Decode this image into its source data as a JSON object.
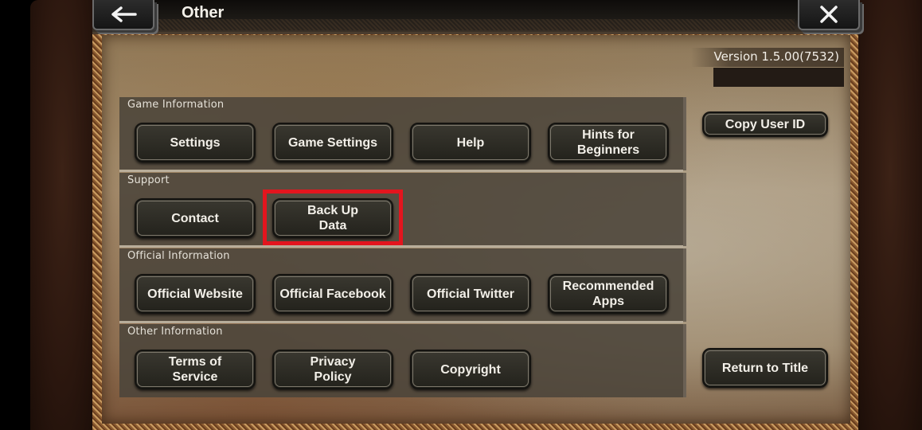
{
  "header": {
    "title": "Other",
    "back_icon": "arrow-left-icon",
    "close_icon": "close-x-icon"
  },
  "version": {
    "label": "Version 1.5.00(7532)"
  },
  "sections": [
    {
      "label": "Game Information",
      "buttons": [
        "Settings",
        "Game Settings",
        "Help",
        "Hints for Beginners"
      ]
    },
    {
      "label": "Support",
      "buttons": [
        "Contact",
        "Back Up\nData"
      ]
    },
    {
      "label": "Official Information",
      "buttons": [
        "Official Website",
        "Official Facebook",
        "Official Twitter",
        "Recommended\nApps"
      ]
    },
    {
      "label": "Other Information",
      "buttons": [
        "Terms of\nService",
        "Privacy\nPolicy",
        "Copyright"
      ]
    }
  ],
  "side": {
    "copy_user_id": "Copy User ID",
    "return_to_title": "Return to Title"
  },
  "highlight": {
    "target": "Back Up Data",
    "color": "#e3151e"
  }
}
